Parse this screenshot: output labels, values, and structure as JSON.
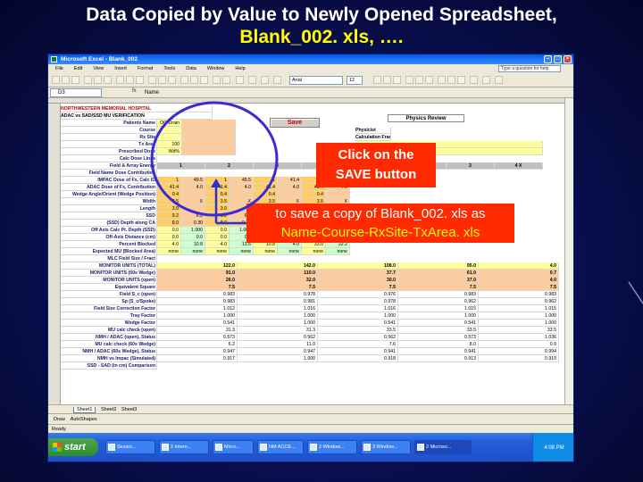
{
  "slide": {
    "title_line1": "Data Copied by  Value to Newly Opened Spreadsheet,",
    "title_line2": "Blank_002. xls, …."
  },
  "excel": {
    "window_title": "Microsoft Excel - Blank_002",
    "menu": [
      "File",
      "Edit",
      "View",
      "Insert",
      "Format",
      "Tools",
      "Data",
      "Window",
      "Help"
    ],
    "help_placeholder": "Type a question for help",
    "font_name": "Arial",
    "font_size": "12",
    "name_box": "D3",
    "formula_value": "Name",
    "save_button_label": "Save",
    "physics_review_label": "Physics Review",
    "sheet_tabs": [
      "Sheet1",
      "Sheet2",
      "Sheet3"
    ],
    "draw_label": "Draw",
    "autoshapes_label": "AutoShapes",
    "status": "Ready",
    "taskbar": {
      "start_label": "start",
      "items": [
        "Sessio...",
        "2 Intern...",
        "Micro...",
        "NM ACCE...",
        "2 Window...",
        "3 Window...",
        "2 Microso..."
      ],
      "clock": "4:08 PM"
    },
    "header_rows": [
      "NORTHWESTERN MEMORIAL HOSPITAL",
      "ADAC vs SAD/SSD MU VERIFICATION"
    ],
    "left_labels": [
      "Patients Name",
      "Course",
      "Rx Site",
      "Tx Area",
      "Prescribed Dose",
      "Calc Dose Lines",
      "Field & Array Energy",
      "Field Name  Dose Contribution",
      "IMPAC Dose of Fx, Calc ID",
      "ADAC Dose of Fx, Contribution",
      "Wedge Angle/Orient (Wedge Position)",
      "Width",
      "Length",
      "SSD",
      "(SSD) Depth along CA",
      "Off Axis Calc Pt. Depth (SSD)",
      "Off-Axis Distance (cm)",
      "Percent Blocked",
      "Expected MU (Blocked Area)",
      "MLC Field Size / Fract",
      "MONITOR UNITS (TOTAL)",
      "MONITOR UNITS (60s Wedge)",
      "MONITOR UNITS (open)",
      "Equivalent Square",
      "Field S_c (open)",
      "Sp (S_c/Spoke)",
      "Field Size Correction Factor",
      "Tray Factor",
      "Wedge Factor",
      "MU calc check (open)",
      "NMH / ADAC (open), Status",
      "MU calc check (60s Wedge)",
      "NMH / ADAC (60s Wedge), Status",
      "NMH vs Impac (Simulated)",
      "SSD - SAD (in cm) Comparison"
    ],
    "input_values": [
      "OO Drain",
      "",
      "",
      "100",
      "Wd%"
    ],
    "right_labels": [
      "Physicist",
      "Calculation Frames/Chart Timestamp"
    ],
    "field_headers": [
      "1",
      "2",
      "3",
      "4 X",
      "1",
      "2",
      "3",
      "4 X"
    ],
    "rows_block_a": [
      [
        "1",
        "49.5",
        "1",
        "45.5",
        "1",
        "41.4",
        "1",
        "4.0"
      ],
      [
        "41.4",
        "4.0",
        "41.4",
        "4.0",
        "41.4",
        "4.0",
        "41.4",
        "4.0"
      ],
      [
        "0.4",
        "",
        "0.4",
        "",
        "0.4",
        "",
        "0.4",
        ""
      ],
      [
        "3.5",
        "X",
        "3.5",
        "X",
        "3.5",
        "X",
        "3.5",
        "X"
      ],
      [
        "3.0",
        "",
        "3.0",
        "",
        "3.0",
        "",
        "3.0",
        ""
      ],
      [
        "9.2",
        "6.2",
        "9.2",
        "6.2",
        "9.2",
        "6.2",
        "9.2",
        "6.2"
      ],
      [
        "8.0",
        "0.30",
        "8.0",
        "0.30",
        "8.0",
        "0.30",
        "8.0",
        "0.30"
      ],
      [
        "0.0",
        "1.000",
        "0.0",
        "1.000",
        "33.0",
        "1.000",
        "0.0",
        "1.000"
      ],
      [
        "0.0",
        "0.0",
        "0.0",
        "0.0",
        "0.0",
        "0.0",
        "0.0",
        "0.0"
      ],
      [
        "4.0",
        "10.8",
        "4.0",
        "13.6",
        "10.8",
        "4.0",
        "33.0",
        "22.2"
      ],
      [
        "none",
        "none",
        "none",
        "none",
        "none",
        "none",
        "none",
        "none"
      ]
    ],
    "mu_totals": [
      [
        "122.0",
        "142.0",
        "108.0",
        "95.0",
        "4.0"
      ],
      [
        "91.0",
        "110.0",
        "37.7",
        "61.0",
        "0.7"
      ],
      [
        "26.0",
        "32.0",
        "30.0",
        "37.0",
        "4.0"
      ],
      [
        "7.5",
        "7.5",
        "7.5",
        "7.5",
        "7.5"
      ]
    ],
    "rows_block_b": [
      [
        "0.983",
        "0.978",
        "0.976",
        "0.983",
        "0.983"
      ],
      [
        "0.983",
        "0.981",
        "0.978",
        "0.962",
        "0.962"
      ],
      [
        "1.012",
        "1.016",
        "1.016",
        "1.015",
        "1.015"
      ],
      [
        "1.000",
        "1.000",
        "1.000",
        "1.000",
        "1.000"
      ],
      [
        "0.541",
        "1.000",
        "0.541",
        "0.541",
        "1.000"
      ],
      [
        "31.3",
        "31.3",
        "33.5",
        "33.5",
        "33.5"
      ],
      [
        "0.573",
        "0.562",
        "0.562",
        "0.573",
        "1.036"
      ],
      [
        "6.2",
        "11.0",
        "7.6",
        "8.0",
        "0.9"
      ],
      [
        "0.947",
        "0.947",
        "0.941",
        "0.941",
        "0.994"
      ],
      [
        "0.917",
        "1.000",
        "0.918",
        "0.913",
        "0.919"
      ]
    ],
    "annotation_1": "Click on the SAVE button",
    "annotation_1_line1": "Click on the",
    "annotation_1_line2": "SAVE button",
    "annotation_2_line1": "to save a copy of Blank_002. xls as",
    "annotation_2_line2": "Name-Course-RxSite-TxArea. xls"
  }
}
